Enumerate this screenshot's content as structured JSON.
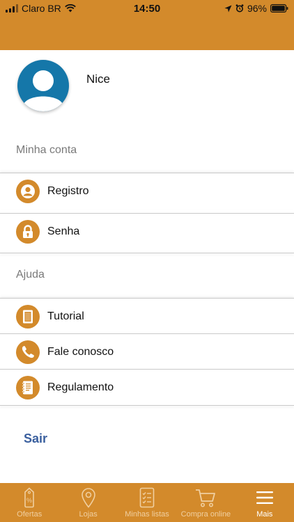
{
  "status": {
    "carrier": "Claro BR",
    "time": "14:50",
    "battery": "96%"
  },
  "colors": {
    "accent": "#d38a2b",
    "avatar_bg": "#1577a9",
    "logout": "#3a5f9e"
  },
  "profile": {
    "name": "Nice"
  },
  "sections": {
    "account": "Minha conta",
    "help": "Ajuda"
  },
  "menu": {
    "registro": "Registro",
    "senha": "Senha",
    "tutorial": "Tutorial",
    "fale_conosco": "Fale conosco",
    "regulamento": "Regulamento"
  },
  "logout_label": "Sair",
  "tabs": [
    {
      "label": "Ofertas",
      "icon": "offers-tag-icon"
    },
    {
      "label": "Lojas",
      "icon": "location-pin-icon"
    },
    {
      "label": "Minhas listas",
      "icon": "checklist-icon"
    },
    {
      "label": "Compra online",
      "icon": "cart-icon"
    },
    {
      "label": "Mais",
      "icon": "menu-icon",
      "active": true
    }
  ]
}
